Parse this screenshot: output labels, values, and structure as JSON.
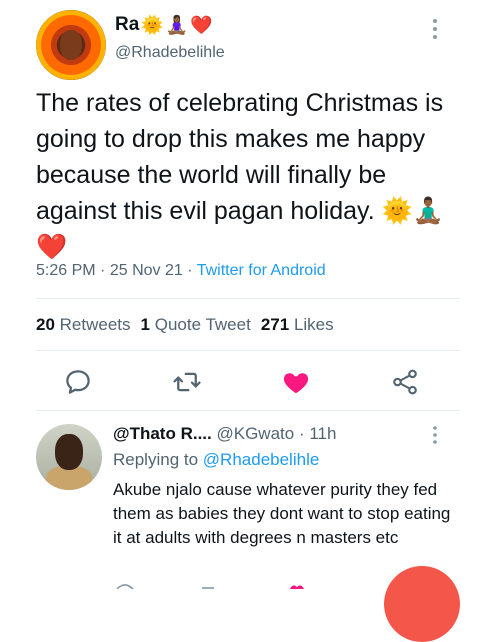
{
  "tweet": {
    "author_name": "Ra",
    "author_emoji": [
      "🌞",
      "🧘🏾‍♀️",
      "❤️"
    ],
    "handle": "@Rhadebelihle",
    "text": "The rates of celebrating Christmas is going to drop this makes me happy because the world will finally be against this evil pagan holiday.",
    "text_emoji": [
      "🌞",
      "🧘🏾‍♂️",
      "❤️"
    ],
    "time": "5:26 PM",
    "date": "25 Nov 21",
    "source": "Twitter for Android",
    "retweets_count": "20",
    "retweets_label": "Retweets",
    "quotes_count": "1",
    "quotes_label": "Quote Tweet",
    "likes_count": "271",
    "likes_label": "Likes"
  },
  "icons": {
    "reply": "reply-bubble-icon",
    "retweet": "retweet-icon",
    "like": "heart-filled-icon",
    "share": "share-icon",
    "more": "more-vertical-icon"
  },
  "colors": {
    "accent": "#1d9bf0",
    "like": "#f91880",
    "secondary_text": "#536471",
    "fab": "#f4564a"
  },
  "reply": {
    "author_name": "@Thato R....",
    "handle": "@KGwato",
    "age": "11h",
    "replying_to_label": "Replying to",
    "replying_to_handle": "@Rhadebelihle",
    "text": "Akube njalo cause whatever purity they fed them as babies they dont want to stop eating it at adults with degrees n masters etc"
  }
}
